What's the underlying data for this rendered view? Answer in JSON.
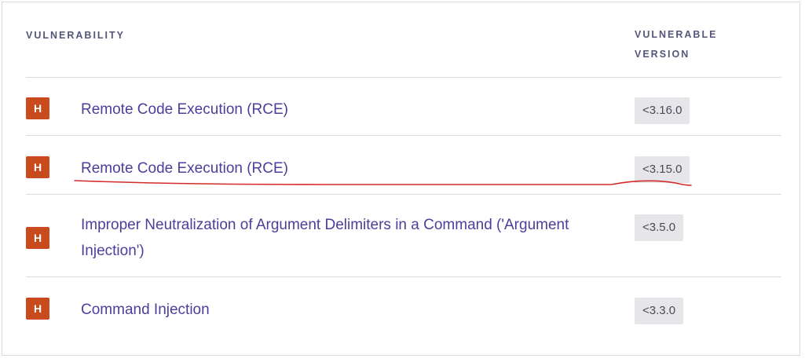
{
  "table": {
    "header": {
      "vulnerability": "VULNERABILITY",
      "vulnerable_version_line1": "VULNERABLE",
      "vulnerable_version_line2": "VERSION"
    },
    "rows": [
      {
        "severity": "H",
        "title": "Remote Code Execution (RCE)",
        "version": "<3.16.0"
      },
      {
        "severity": "H",
        "title": "Remote Code Execution (RCE)",
        "version": "<3.15.0"
      },
      {
        "severity": "H",
        "title_line1": "Improper Neutralization of Argument Delimiters in a Command ('Argument",
        "title_line2": "Injection')",
        "version": "<3.5.0"
      },
      {
        "severity": "H",
        "title": "Command Injection",
        "version": "<3.3.0"
      }
    ]
  },
  "colors": {
    "severity_high": "#c94a1c",
    "link": "#4a3f9a",
    "annotation": "#d42a2a"
  }
}
